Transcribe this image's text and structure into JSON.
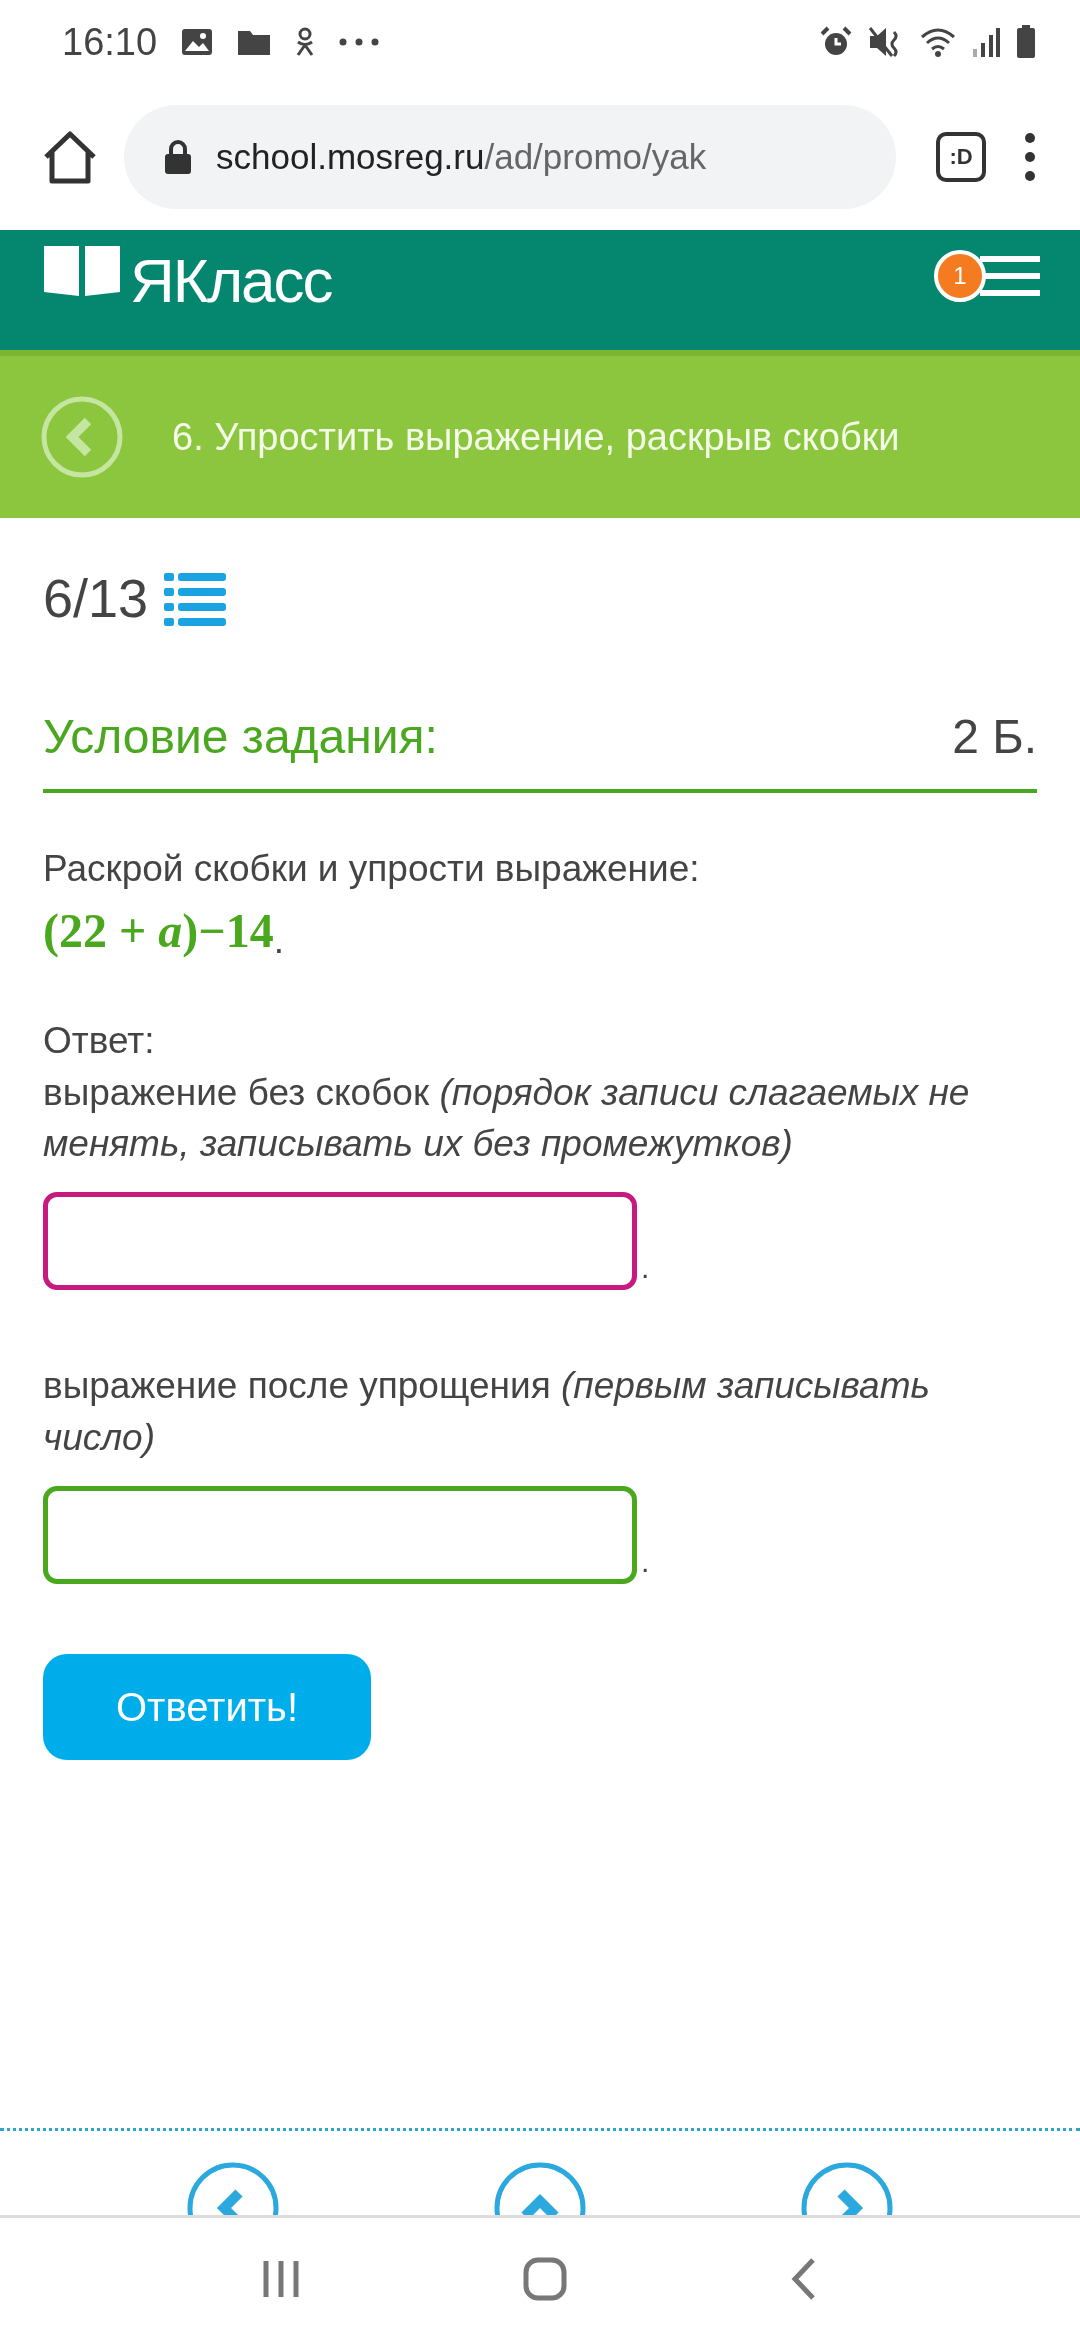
{
  "status_bar": {
    "time": "16:10"
  },
  "browser": {
    "url_host": "school.mosreg.ru",
    "url_path": "/ad/promo/yak",
    "tab_button": ":D"
  },
  "header": {
    "logo": "ЯКласс",
    "notification_count": "1"
  },
  "title_bar": {
    "title": "6. Упростить выражение, раскрыв скобки"
  },
  "progress": {
    "counter": "6/13"
  },
  "task": {
    "heading": "Условие задания:",
    "points": "2 Б.",
    "prompt": "Раскрой скобки и упрости выражение:",
    "expression": "(22 + *a*)−14",
    "expression_end": "."
  },
  "answer": {
    "label": "Ответ:",
    "fields": [
      {
        "label": "выражение без скобок *(порядок записи слагаемых не менять, записывать их без промежутков)*",
        "focused": true,
        "suffix": "."
      },
      {
        "label": "выражение после упрощения *(первым записывать число)*",
        "focused": false,
        "suffix": "."
      }
    ]
  },
  "submit_button": "Ответить!"
}
